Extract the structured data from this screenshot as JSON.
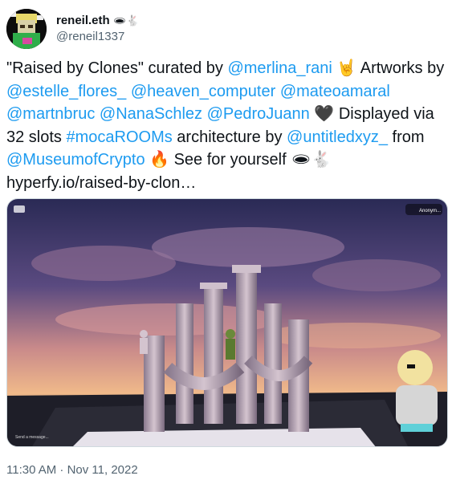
{
  "author": {
    "display_name": "reneil.eth",
    "name_emoji": "🕳🐇",
    "handle": "@reneil1337"
  },
  "tweet": {
    "segments": [
      {
        "type": "text",
        "text": "\"Raised by Clones\" curated by "
      },
      {
        "type": "mention",
        "text": "@merlina_rani"
      },
      {
        "type": "text",
        "text": " 🤘 Artworks by "
      },
      {
        "type": "mention",
        "text": "@estelle_flores_"
      },
      {
        "type": "text",
        "text": " "
      },
      {
        "type": "mention",
        "text": "@heaven_computer"
      },
      {
        "type": "text",
        "text": " "
      },
      {
        "type": "mention",
        "text": "@mateoamaral"
      },
      {
        "type": "text",
        "text": " "
      },
      {
        "type": "mention",
        "text": "@martnbruc"
      },
      {
        "type": "text",
        "text": " "
      },
      {
        "type": "mention",
        "text": "@NanaSchlez"
      },
      {
        "type": "text",
        "text": " "
      },
      {
        "type": "mention",
        "text": "@PedroJuann"
      },
      {
        "type": "text",
        "text": " 🖤 Displayed via 32 slots "
      },
      {
        "type": "hashtag",
        "text": "#mocaROOMs"
      },
      {
        "type": "text",
        "text": " architecture by "
      },
      {
        "type": "mention",
        "text": "@untitledxyz_"
      },
      {
        "type": "text",
        "text": " from "
      },
      {
        "type": "mention",
        "text": "@MuseumofCrypto"
      },
      {
        "type": "text",
        "text": " 🔥 See for yourself 🕳🐇 "
      },
      {
        "type": "link",
        "text": "hyperfy.io/raised-by-clon…"
      }
    ],
    "timestamp": "11:30 AM · Nov 11, 2022"
  },
  "media": {
    "overlay_top_right": "Anonym...",
    "overlay_bottom_left": "Send a message..."
  },
  "colors": {
    "link": "#1d9bf0",
    "text": "#0f1419",
    "secondary": "#536471"
  }
}
